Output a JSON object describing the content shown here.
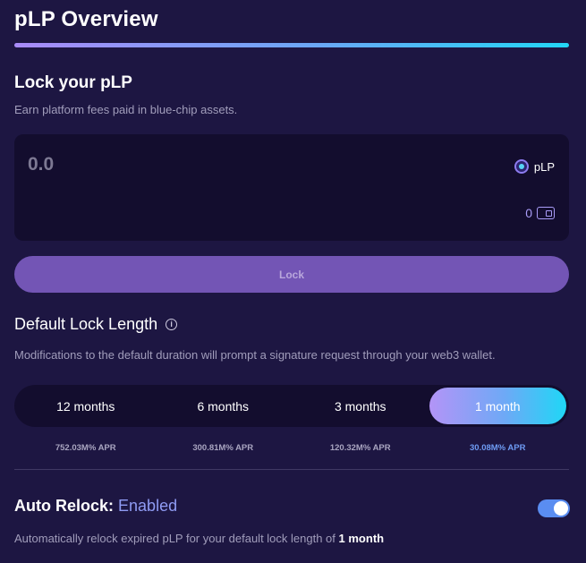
{
  "header": {
    "title": "pLP Overview"
  },
  "lock_section": {
    "title": "Lock your pLP",
    "subtitle": "Earn platform fees paid in blue-chip assets.",
    "amount_placeholder": "0.0",
    "token_label": "pLP",
    "token_icon": "plp-token-icon",
    "balance": "0",
    "wallet_icon": "wallet-icon",
    "lock_button": "Lock"
  },
  "lock_length": {
    "title": "Default Lock Length",
    "description": "Modifications to the default duration will prompt a signature request through your web3 wallet.",
    "options": [
      {
        "label": "12 months",
        "apr": "752.03M% APR",
        "selected": false
      },
      {
        "label": "6 months",
        "apr": "300.81M% APR",
        "selected": false
      },
      {
        "label": "3 months",
        "apr": "120.32M% APR",
        "selected": false
      },
      {
        "label": "1 month",
        "apr": "30.08M% APR",
        "selected": true
      }
    ]
  },
  "auto_relock": {
    "label": "Auto Relock:",
    "status": "Enabled",
    "enabled": true,
    "description_prefix": "Automatically relock expired pLP for your default lock length of",
    "description_value": "1 month"
  },
  "colors": {
    "background": "#1d1642",
    "card": "#130d2e",
    "accent_gradient_start": "#b394f7",
    "accent_gradient_end": "#1fd7f6",
    "lock_button": "#7355b5",
    "toggle_on": "#5a8df1"
  }
}
